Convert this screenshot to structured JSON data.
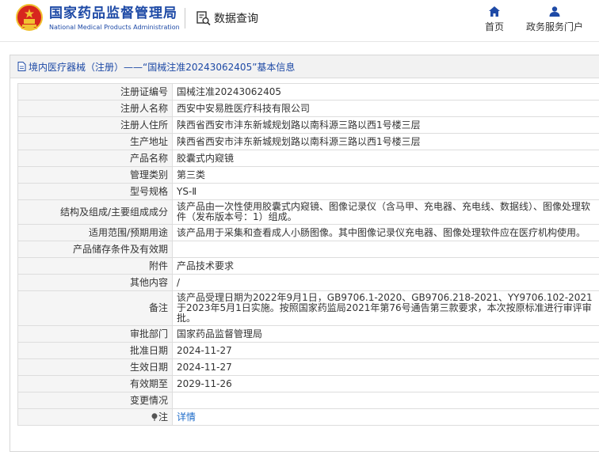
{
  "header": {
    "brand_cn": "国家药品监督管理局",
    "brand_en": "National Medical Products Administration",
    "data_query": "数据查询",
    "nav_home": "首页",
    "nav_service": "政务服务门户"
  },
  "panel": {
    "title": "境内医疗器械（注册）——“国械注准20243062405”基本信息"
  },
  "rows": [
    {
      "label": "注册证编号",
      "value": "国械注准20243062405"
    },
    {
      "label": "注册人名称",
      "value": "西安中安易胜医疗科技有限公司"
    },
    {
      "label": "注册人住所",
      "value": "陕西省西安市沣东新城规划路以南科源三路以西1号楼三层"
    },
    {
      "label": "生产地址",
      "value": "陕西省西安市沣东新城规划路以南科源三路以西1号楼三层"
    },
    {
      "label": "产品名称",
      "value": "胶囊式内窥镜"
    },
    {
      "label": "管理类别",
      "value": "第三类"
    },
    {
      "label": "型号规格",
      "value": "YS-Ⅱ"
    },
    {
      "label": "结构及组成/主要组成成分",
      "value": "该产品由一次性使用胶囊式内窥镜、图像记录仪（含马甲、充电器、充电线、数据线）、图像处理软件（发布版本号：1）组成。"
    },
    {
      "label": "适用范围/预期用途",
      "value": "该产品用于采集和查看成人小肠图像。其中图像记录仪充电器、图像处理软件应在医疗机构使用。"
    },
    {
      "label": "产品储存条件及有效期",
      "value": ""
    },
    {
      "label": "附件",
      "value": "产品技术要求"
    },
    {
      "label": "其他内容",
      "value": "/"
    },
    {
      "label": "备注",
      "value": "该产品受理日期为2022年9月1日，GB9706.1-2020、GB9706.218-2021、YY9706.102-2021于2023年5月1日实施。按照国家药监局2021年第76号通告第三款要求，本次按原标准进行审评审批。"
    },
    {
      "label": "审批部门",
      "value": "国家药品监督管理局"
    },
    {
      "label": "批准日期",
      "value": "2024-11-27"
    },
    {
      "label": "生效日期",
      "value": "2024-11-27"
    },
    {
      "label": "有效期至",
      "value": "2029-11-26"
    },
    {
      "label": "变更情况",
      "value": ""
    },
    {
      "label": "注",
      "value": "详情"
    }
  ],
  "colors": {
    "brand_blue": "#1e4aa6",
    "link_blue": "#1e6bc9",
    "emblem_red": "#d7261e",
    "emblem_gold": "#f1c232"
  },
  "icons": [
    "national-emblem-icon",
    "data-query-icon",
    "home-icon",
    "user-icon",
    "document-icon",
    "pin-icon"
  ]
}
